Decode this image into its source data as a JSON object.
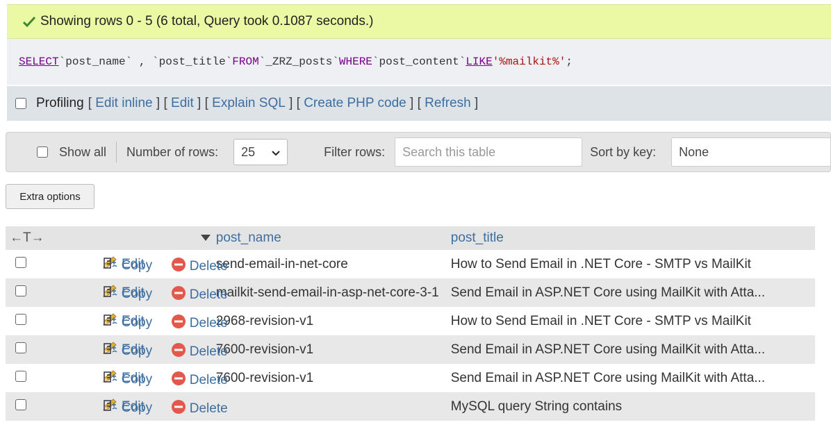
{
  "success": {
    "message": "Showing rows 0 - 5 (6 total, Query took 0.1087 seconds.)"
  },
  "sql": {
    "select": "SELECT",
    "col1": "`post_name`",
    "comma": " , ",
    "col2": "`post_title`",
    "from": "FROM",
    "table": "`_ZRZ_posts`",
    "where": "WHERE",
    "col3": "`post_content`",
    "like": "LIKE",
    "pattern": "'%mailkit%'",
    "end": ";"
  },
  "links": {
    "profiling": "Profiling",
    "edit_inline": "Edit inline",
    "edit": "Edit",
    "explain": "Explain SQL",
    "php": "Create PHP code",
    "refresh": "Refresh",
    "bracket_open": "[",
    "bracket_close": "]"
  },
  "nav": {
    "show_all": "Show all",
    "num_rows_label": "Number of rows:",
    "num_rows_value": "25",
    "filter_label": "Filter rows:",
    "filter_placeholder": "Search this table",
    "sort_label": "Sort by key:",
    "sort_value": "None"
  },
  "extra_options": "Extra options",
  "table": {
    "arrows": "←T→",
    "col_name": "post_name",
    "col_title": "post_title",
    "actions": {
      "edit": "Edit",
      "copy": "Copy",
      "delete": "Delete"
    },
    "rows": [
      {
        "name": "send-email-in-net-core",
        "title": "How to Send Email in .NET Core - SMTP vs MailKit"
      },
      {
        "name": "mailkit-send-email-in-asp-net-core-3-1",
        "title": "Send Email in ASP.NET Core using MailKit with Atta..."
      },
      {
        "name": "2968-revision-v1",
        "title": "How to Send Email in .NET Core - SMTP vs MailKit"
      },
      {
        "name": "7600-revision-v1",
        "title": "Send Email in ASP.NET Core using MailKit with Atta..."
      },
      {
        "name": "7600-revision-v1",
        "title": "Send Email in ASP.NET Core using MailKit with Atta..."
      },
      {
        "name": "",
        "title": "MySQL query String contains"
      }
    ]
  }
}
